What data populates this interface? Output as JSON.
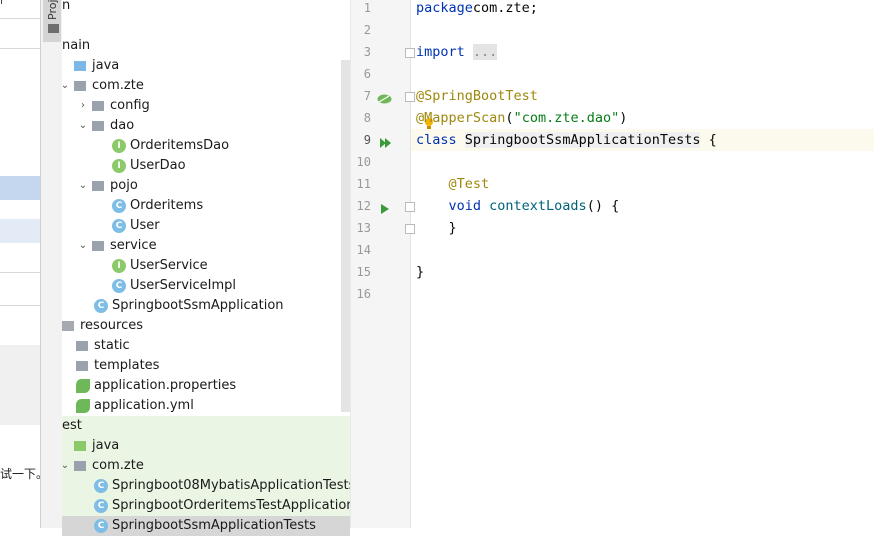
{
  "background": {
    "partial_top_text": "r",
    "partial_chinese_text": "试一下。"
  },
  "tool_strip": {
    "project_tab": "Proj"
  },
  "tree": [
    {
      "label": "n",
      "indent": 0,
      "kind": "none",
      "arrow": ""
    },
    {
      "label": "nain",
      "indent": 0,
      "kind": "none",
      "arrow": ""
    },
    {
      "label": "java",
      "indent": 12,
      "kind": "src",
      "arrow": ""
    },
    {
      "label": "com.zte",
      "indent": 12,
      "kind": "pkg",
      "arrow": "v"
    },
    {
      "label": "config",
      "indent": 30,
      "kind": "pkg",
      "arrow": ">"
    },
    {
      "label": "dao",
      "indent": 30,
      "kind": "pkg",
      "arrow": "v"
    },
    {
      "label": "OrderitemsDao",
      "indent": 50,
      "kind": "interface",
      "arrow": ""
    },
    {
      "label": "UserDao",
      "indent": 50,
      "kind": "interface",
      "arrow": ""
    },
    {
      "label": "pojo",
      "indent": 30,
      "kind": "pkg",
      "arrow": "v"
    },
    {
      "label": "Orderitems",
      "indent": 50,
      "kind": "class",
      "arrow": ""
    },
    {
      "label": "User",
      "indent": 50,
      "kind": "class",
      "arrow": ""
    },
    {
      "label": "service",
      "indent": 30,
      "kind": "pkg",
      "arrow": "v"
    },
    {
      "label": "UserService",
      "indent": 50,
      "kind": "interface",
      "arrow": ""
    },
    {
      "label": "UserServiceImpl",
      "indent": 50,
      "kind": "class",
      "arrow": ""
    },
    {
      "label": "SpringbootSsmApplication",
      "indent": 32,
      "kind": "springclass",
      "arrow": ""
    },
    {
      "label": "resources",
      "indent": 0,
      "kind": "res",
      "arrow": ""
    },
    {
      "label": "static",
      "indent": 14,
      "kind": "pkg",
      "arrow": ""
    },
    {
      "label": "templates",
      "indent": 14,
      "kind": "pkg",
      "arrow": ""
    },
    {
      "label": "application.properties",
      "indent": 14,
      "kind": "leaf",
      "arrow": ""
    },
    {
      "label": "application.yml",
      "indent": 14,
      "kind": "leaf",
      "arrow": ""
    },
    {
      "label": "est",
      "indent": 0,
      "kind": "none",
      "arrow": "",
      "green": true
    },
    {
      "label": "java",
      "indent": 12,
      "kind": "test",
      "arrow": "",
      "green": true
    },
    {
      "label": "com.zte",
      "indent": 12,
      "kind": "pkg",
      "arrow": "v",
      "green": true
    },
    {
      "label": "Springboot08MybatisApplicationTests",
      "indent": 32,
      "kind": "springclass",
      "arrow": "",
      "green": true
    },
    {
      "label": "SpringbootOrderitemsTestApplication",
      "indent": 32,
      "kind": "springclass",
      "arrow": "",
      "green": true
    },
    {
      "label": "SpringbootSsmApplicationTests",
      "indent": 32,
      "kind": "springclass",
      "arrow": "",
      "sel": true
    }
  ],
  "editor": {
    "lines": [
      {
        "n": "1",
        "tokens": [
          [
            "kw",
            "package"
          ],
          [
            "",
            "com.zte;"
          ]
        ]
      },
      {
        "n": "2",
        "tokens": []
      },
      {
        "n": "3",
        "tokens": [
          [
            "kw",
            "import "
          ],
          [
            "fold",
            "..."
          ]
        ]
      },
      {
        "n": "6",
        "tokens": []
      },
      {
        "n": "7",
        "tokens": [
          [
            "ann",
            "@SpringBootTest"
          ]
        ]
      },
      {
        "n": "8",
        "tokens": [
          [
            "ann",
            "@"
          ],
          [
            "ann",
            "MapperScan"
          ],
          [
            "",
            "("
          ],
          [
            "str",
            "\"com.zte.dao\""
          ],
          [
            "",
            ")"
          ]
        ]
      },
      {
        "n": "9",
        "tokens": [
          [
            "kw",
            "class "
          ],
          [
            "caret",
            ""
          ],
          [
            "ul",
            "SpringbootSsmApplicationTests"
          ],
          [
            "",
            " {"
          ]
        ]
      },
      {
        "n": "10",
        "tokens": []
      },
      {
        "n": "11",
        "tokens": [
          [
            "",
            "    "
          ],
          [
            "ann",
            "@Test"
          ]
        ]
      },
      {
        "n": "12",
        "tokens": [
          [
            "",
            "    "
          ],
          [
            "kw",
            "void "
          ],
          [
            "fn",
            "contextLoads"
          ],
          [
            "",
            "() {"
          ]
        ]
      },
      {
        "n": "13",
        "tokens": [
          [
            "",
            "    }"
          ]
        ]
      },
      {
        "n": "14",
        "tokens": []
      },
      {
        "n": "15",
        "tokens": [
          [
            "",
            "}"
          ]
        ]
      },
      {
        "n": "16",
        "tokens": []
      }
    ]
  }
}
